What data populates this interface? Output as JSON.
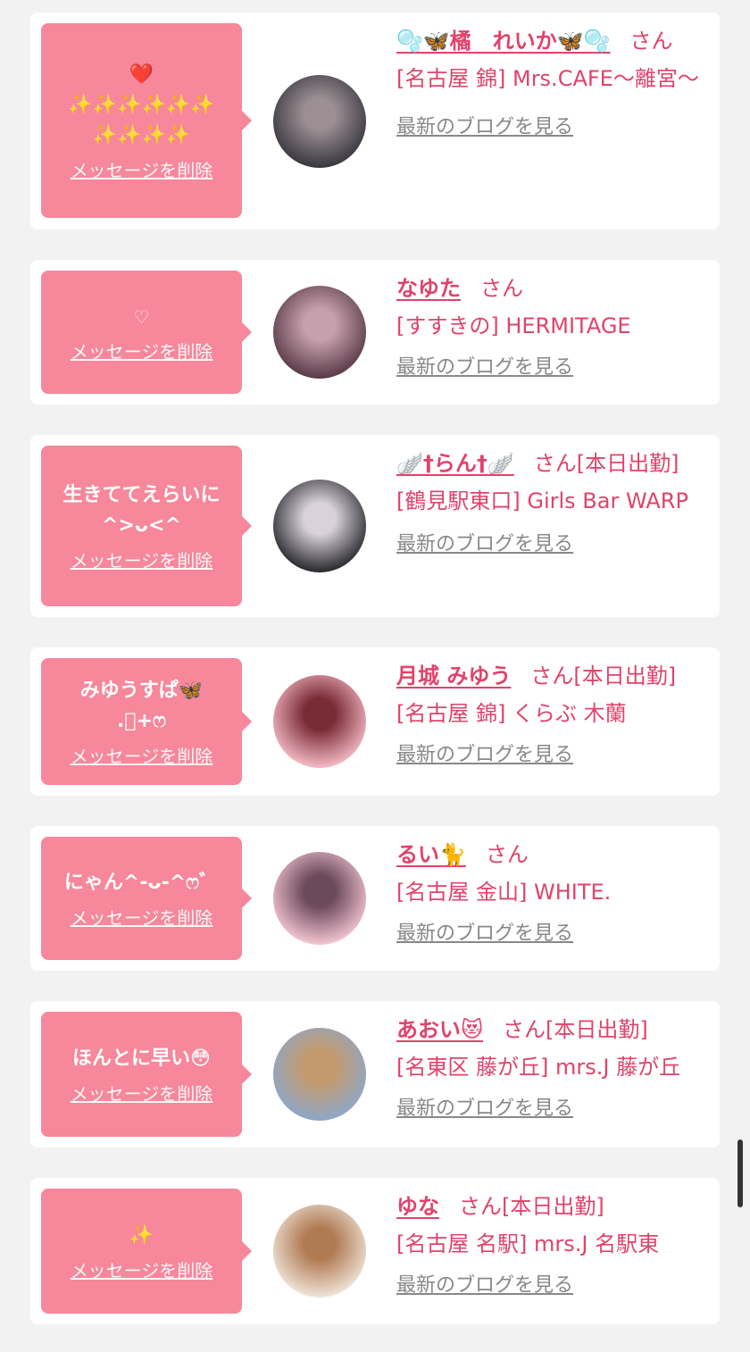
{
  "cards": [
    {
      "message": "❤️\n✨✨✨✨✨✨\n✨✨✨✨",
      "delete_label": "メッセージを削除",
      "name": "🫧🦋橘　れいか🦋🫧",
      "honorific": "さん",
      "status": "",
      "shop": "[名古屋 錦] Mrs.CAFE〜離宮〜",
      "blog_label": "最新のブログを見る",
      "avatar_colors": [
        "#3a3840",
        "#9b8f93"
      ]
    },
    {
      "message": "♡",
      "delete_label": "メッセージを削除",
      "name": "なゆた",
      "honorific": "さん",
      "status": "",
      "shop": "[すすきの] HERMITAGE",
      "blog_label": "最新のブログを見る",
      "avatar_colors": [
        "#5a3b48",
        "#c7a0ad"
      ]
    },
    {
      "message": "生きててえらいに\n^>ᴗ<^",
      "delete_label": "メッセージを削除",
      "name": "🪽†らん†🪽",
      "honorific": "さん",
      "status": "[本日出勤]",
      "shop": "[鶴見駅東口] Girls Bar WARP",
      "blog_label": "最新のブログを見る",
      "avatar_colors": [
        "#2a2a2e",
        "#d9d2dc"
      ]
    },
    {
      "message": "みゆうすぱ🦋\n.ﾟ+ෆ",
      "delete_label": "メッセージを削除",
      "name": "月城 みゆう",
      "honorific": "さん",
      "status": "[本日出勤]",
      "shop": "[名古屋 錦] くらぶ 木蘭",
      "blog_label": "最新のブログを見る",
      "avatar_colors": [
        "#f3b9c4",
        "#7a2c36"
      ]
    },
    {
      "message": "にゃん^-ᴗ-^ෆ゛",
      "delete_label": "メッセージを削除",
      "name": "るい🐈",
      "honorific": "さん",
      "status": "",
      "shop": "[名古屋 金山] WHITE.",
      "blog_label": "最新のブログを見る",
      "avatar_colors": [
        "#f2c3d0",
        "#6b4a5c"
      ]
    },
    {
      "message": "ほんとに早い😳",
      "delete_label": "メッセージを削除",
      "name": "あおい😻",
      "honorific": "さん",
      "status": "[本日出勤]",
      "shop": "[名東区 藤が丘] mrs.J 藤が丘",
      "blog_label": "最新のブログを見る",
      "avatar_colors": [
        "#8ea7c9",
        "#c49a6c"
      ]
    },
    {
      "message": "✨",
      "delete_label": "メッセージを削除",
      "name": "ゆな",
      "honorific": "さん",
      "status": "[本日出勤]",
      "shop": "[名古屋 名駅] mrs.J 名駅東",
      "blog_label": "最新のブログを見る",
      "avatar_colors": [
        "#efe3d8",
        "#b07a52"
      ]
    }
  ],
  "colors": {
    "accent": "#e0436a",
    "bubble": "#f7879a",
    "background": "#f2f2f2",
    "link_gray": "#888888"
  }
}
